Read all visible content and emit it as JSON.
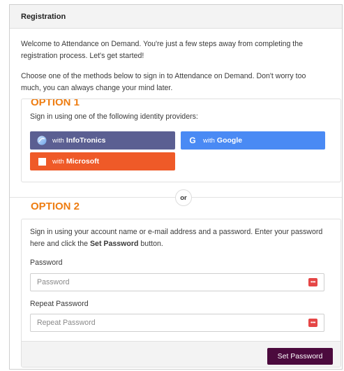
{
  "panel": {
    "title": "Registration"
  },
  "intro": {
    "welcome": "Welcome to Attendance on Demand. You're just a few steps away from completing the registration process. Let's get started!",
    "choose": "Choose one of the methods below to sign in to Attendance on Demand. Don't worry too much, you can always change your mind later."
  },
  "option1": {
    "title": "OPTION 1",
    "hint": "Sign in using one of the following identity providers:",
    "providers": [
      {
        "prefix": "with",
        "name": "InfoTronics",
        "color": "#5b5f92",
        "icon": "infotronics-icon"
      },
      {
        "prefix": "with",
        "name": "Google",
        "color": "#4a8af4",
        "icon": "google-icon"
      },
      {
        "prefix": "with",
        "name": "Microsoft",
        "color": "#ef5a28",
        "icon": "microsoft-icon"
      }
    ]
  },
  "divider": {
    "label": "or"
  },
  "option2": {
    "title": "OPTION 2",
    "instructions_pre": "Sign in using your account name or e-mail address and a password. Enter your password here and click the ",
    "instructions_bold": "Set Password",
    "instructions_post": " button.",
    "password": {
      "label": "Password",
      "placeholder": "Password",
      "value": ""
    },
    "repeat_password": {
      "label": "Repeat Password",
      "placeholder": "Repeat Password",
      "value": ""
    },
    "submit_label": "Set Password",
    "submit_color": "#4b0a3d"
  }
}
